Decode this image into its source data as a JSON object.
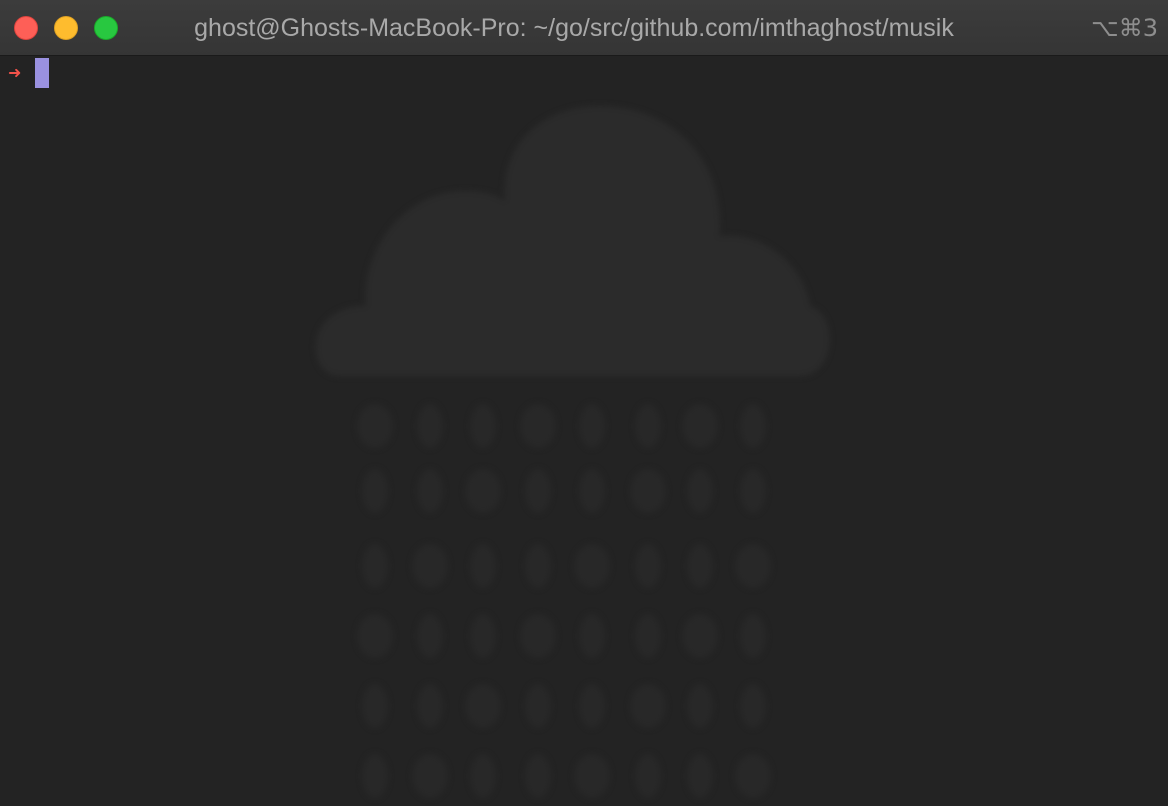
{
  "window": {
    "title": "ghost@Ghosts-MacBook-Pro: ~/go/src/github.com/imthaghost/musik",
    "shortcut": "⌥⌘3",
    "traffic_lights": {
      "close_color": "#fe5f57",
      "minimize_color": "#febc2e",
      "maximize_color": "#28c840"
    }
  },
  "terminal": {
    "prompt_symbol": "➜",
    "prompt_color": "#f2524a",
    "cursor_color": "#9a91e0",
    "background_color": "#232323",
    "watermark_icon": "cloud-rain-icon"
  }
}
